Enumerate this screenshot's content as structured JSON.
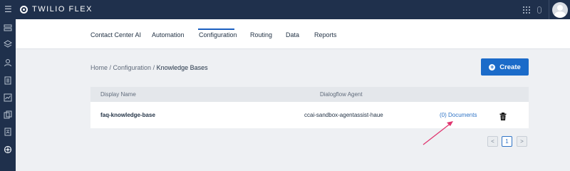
{
  "topbar": {
    "brand": "TWILIO FLEX"
  },
  "subnav": {
    "tabs": [
      {
        "label": "Contact Center AI",
        "active": false
      },
      {
        "label": "Automation",
        "active": false
      },
      {
        "label": "Configuration",
        "active": true
      },
      {
        "label": "Routing",
        "active": false
      },
      {
        "label": "Data",
        "active": false
      },
      {
        "label": "Reports",
        "active": false
      }
    ]
  },
  "breadcrumb": {
    "home": "Home",
    "separator": " / ",
    "section": "Configuration",
    "current": "Knowledge Bases"
  },
  "actions": {
    "create_label": "Create"
  },
  "table": {
    "columns": [
      "Display Name",
      "Dialogflow Agent"
    ],
    "rows": [
      {
        "display_name": "faq-knowledge-base",
        "dialogflow_agent": "ccai-sandbox-agentassist-haue",
        "documents_link": "(0) Documents"
      }
    ]
  },
  "pagination": {
    "prev": "<",
    "current_page": "1",
    "next": ">"
  },
  "colors": {
    "topbar": "#1f304c",
    "accent": "#1b6bc9",
    "link": "#2f74c6",
    "annotation_arrow": "#e0356f"
  }
}
